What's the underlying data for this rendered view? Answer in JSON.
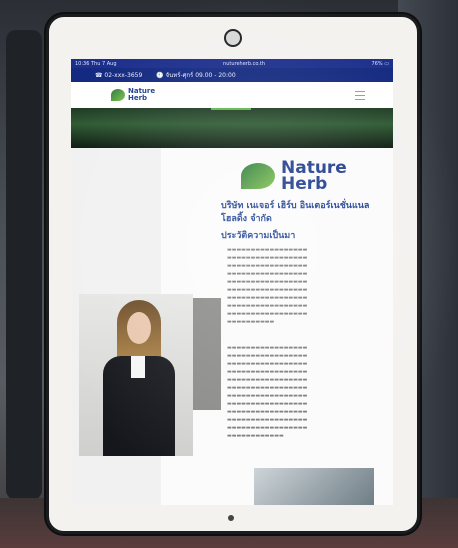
{
  "status_bar": {
    "left": "10:36 Thu 7 Aug",
    "center": "nutureherb.co.th",
    "right": "76% ▭"
  },
  "top_bar": {
    "phone": "☎ 02-xxx-3659",
    "hours": "🕘 จันทร์-ศุกร์ 09.00 - 20:00"
  },
  "brand": {
    "line1": "Nature",
    "line2": "Herb"
  },
  "company_name": "บริษัท เนเจอร์ เฮิร์บ อินเตอร์เนชั่นแนล โฮลดิ้ง จำกัด",
  "history_heading": "ประวัติความเป็นมา",
  "colors": {
    "navy": "#142a80",
    "green": "#5fb848",
    "brand_blue": "#1d3f8f"
  }
}
